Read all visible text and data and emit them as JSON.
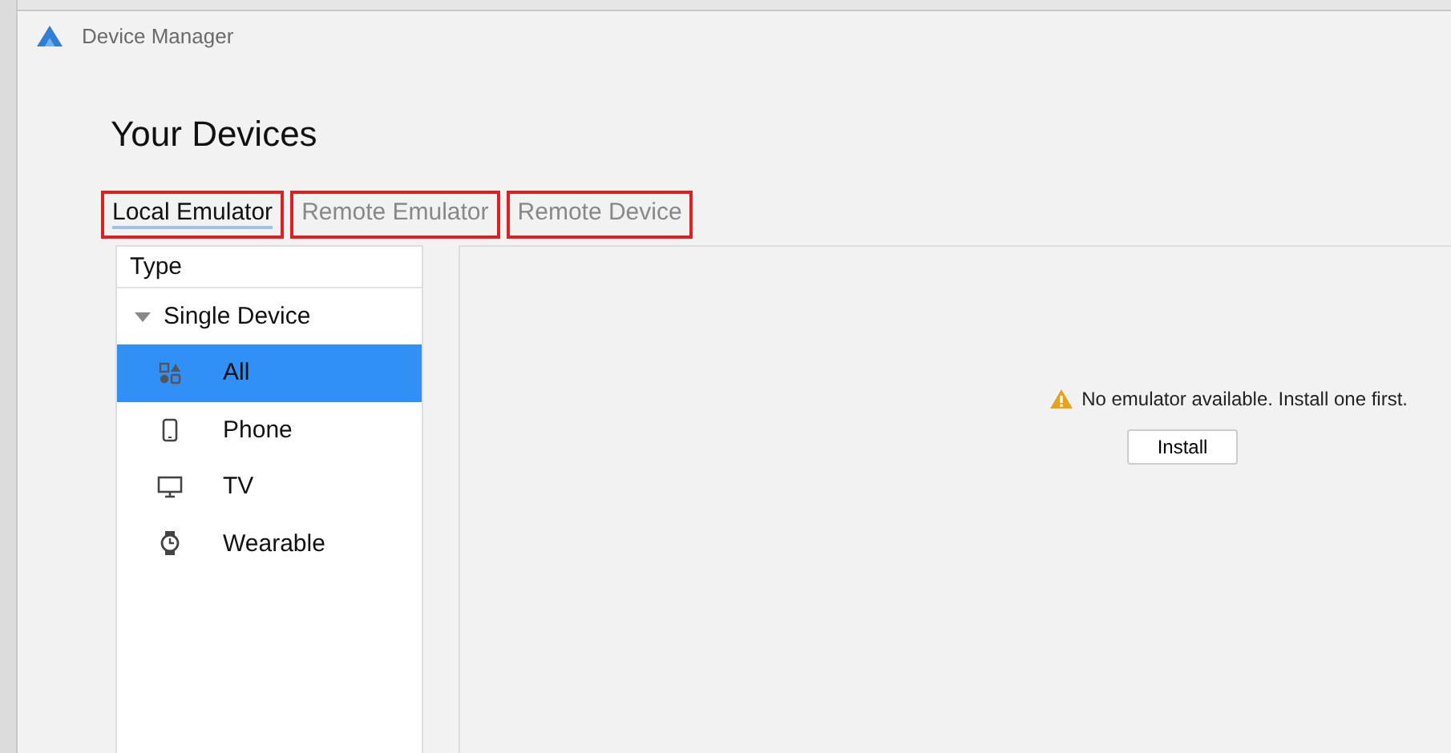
{
  "window": {
    "title": "Device Manager"
  },
  "heading": "Your Devices",
  "tabs": [
    {
      "label": "Local Emulator",
      "selected": true,
      "highlighted": true
    },
    {
      "label": "Remote Emulator",
      "selected": false,
      "highlighted": true
    },
    {
      "label": "Remote Device",
      "selected": false,
      "highlighted": true
    }
  ],
  "sidebar": {
    "header": "Type",
    "groups": [
      {
        "label": "Single Device",
        "expanded": true,
        "children": [
          {
            "label": "All",
            "kind": "all",
            "selected": true
          },
          {
            "label": "Phone",
            "kind": "phone",
            "selected": false
          },
          {
            "label": "TV",
            "kind": "tv",
            "selected": false
          },
          {
            "label": "Wearable",
            "kind": "wearable",
            "selected": false
          }
        ]
      }
    ]
  },
  "empty_state": {
    "message": "No emulator available. Install one first.",
    "button": "Install"
  }
}
